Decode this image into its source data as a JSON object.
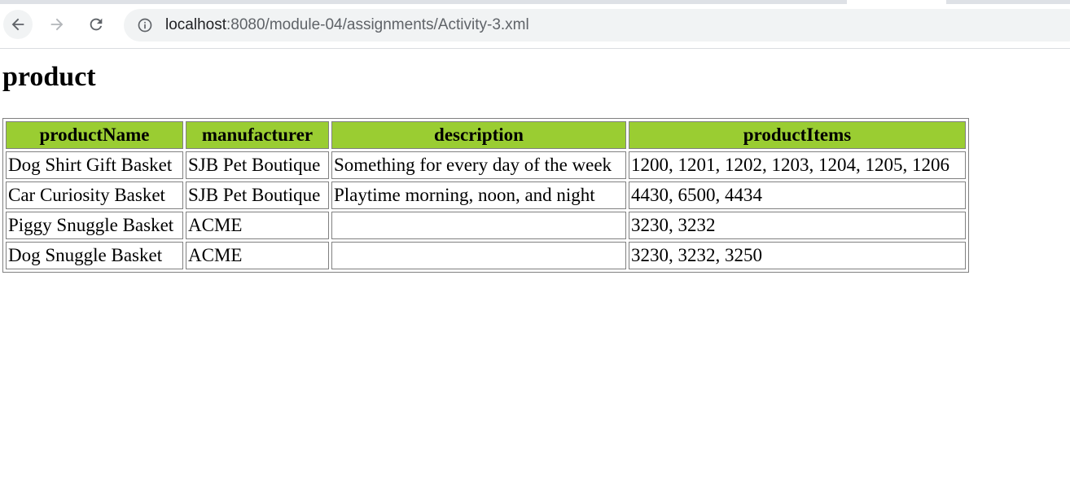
{
  "browser": {
    "url_host": "localhost",
    "url_rest": ":8080/module-04/assignments/Activity-3.xml"
  },
  "page": {
    "title": "product"
  },
  "colors": {
    "header_bg": "#9acd32"
  },
  "table": {
    "headers": [
      "productName",
      "manufacturer",
      "description",
      "productItems"
    ],
    "rows": [
      [
        "Dog Shirt Gift Basket",
        "SJB Pet Boutique",
        "Something for every day of the week",
        "1200, 1201, 1202, 1203, 1204, 1205, 1206"
      ],
      [
        "Car Curiosity Basket",
        "SJB Pet Boutique",
        "Playtime morning, noon, and night",
        "4430, 6500, 4434"
      ],
      [
        "Piggy Snuggle Basket",
        "ACME",
        "",
        "3230, 3232"
      ],
      [
        "Dog Snuggle Basket",
        "ACME",
        "",
        "3230, 3232, 3250"
      ]
    ]
  }
}
